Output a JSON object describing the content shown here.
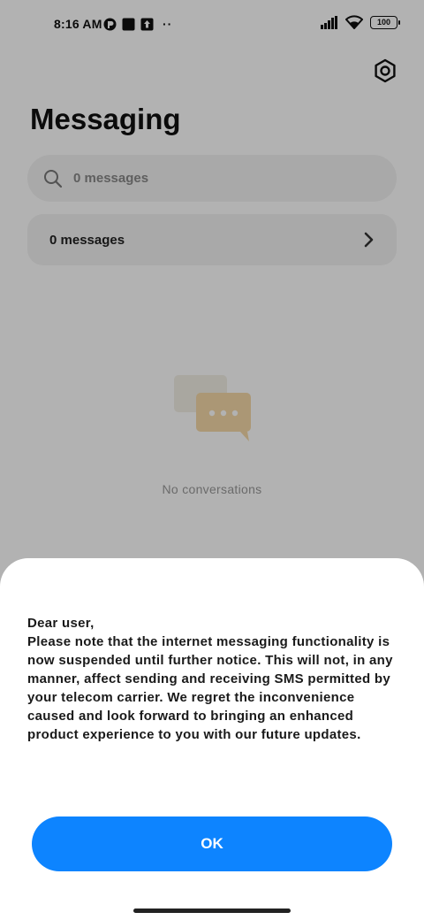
{
  "status_bar": {
    "time": "8:16 AM",
    "left_icons": [
      "app-notification-icon",
      "square-notification-icon",
      "upload-notification-icon"
    ],
    "more_dots": "··",
    "battery": "100"
  },
  "header": {
    "title": "Messaging",
    "settings_icon": "gear-icon"
  },
  "search": {
    "placeholder": "0 messages"
  },
  "messages_row": {
    "label": "0 messages"
  },
  "empty_state": {
    "text": "No conversations"
  },
  "dialog": {
    "lines": [
      "Dear user,",
      "Please note that the internet messaging functionality is now suspended until further notice. This will not, in any manner, affect sending and receiving SMS permitted by your telecom carrier. We regret the inconvenience caused and look forward to bringing an enhanced product experience to you with our future updates."
    ],
    "ok_label": "OK"
  },
  "colors": {
    "accent": "#0d84ff",
    "scrim": "rgba(0,0,0,0.30)"
  }
}
